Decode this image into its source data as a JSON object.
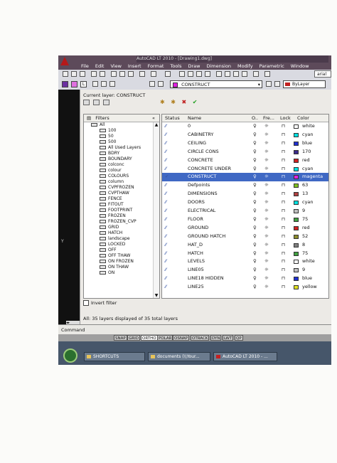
{
  "menubar": {
    "title": "AutoCAD LT 2010 - [Drawing1.dwg]",
    "items": [
      "File",
      "Edit",
      "View",
      "Insert",
      "Format",
      "Tools",
      "Draw",
      "Dimension",
      "Modify",
      "Parametric",
      "Window"
    ]
  },
  "toolbar": {
    "font_box": "arial"
  },
  "layer_toolbar": {
    "current": "CONSTRUCT",
    "color_value": "ByLayer"
  },
  "panel": {
    "current_layer_label": "Current layer: CONSTRUCT",
    "filters_label": "Filters",
    "invert_filter_label": "Invert filter",
    "status_text": "All: 35 layers displayed of 35 total layers",
    "collapse": "«"
  },
  "filter_tree": [
    "All",
    "100",
    "50",
    "500",
    "All Used Layers",
    "BDRY",
    "BOUNDARY",
    "colconc",
    "colour",
    "COLOURS",
    "column",
    "CVPFROZEN",
    "CVPTHAW",
    "FENCE",
    "FITOUT",
    "FOOTPRINT",
    "FROZEN",
    "FROZEN_CVP",
    "GRID",
    "HATCH",
    "landscape",
    "LOCKED",
    "OFF",
    "OFF THAW",
    "ON FROZEN",
    "ON THAW",
    "ON"
  ],
  "columns": {
    "status": "Status",
    "name": "Name",
    "on": "O..",
    "freeze": "Fre...",
    "lock": "Lock",
    "color": "Color"
  },
  "layers": [
    {
      "name": "0",
      "color": "white",
      "hex": "#ffffff"
    },
    {
      "name": "CABINETRY",
      "color": "cyan",
      "hex": "#00e0e0"
    },
    {
      "name": "CEILING",
      "color": "blue",
      "hex": "#2030d0"
    },
    {
      "name": "CIRCLE CONS",
      "color": "170",
      "hex": "#3a2a8c"
    },
    {
      "name": "CONCRETE",
      "color": "red",
      "hex": "#d02020"
    },
    {
      "name": "CONCRETE UNDER",
      "color": "cyan",
      "hex": "#00e0e0"
    },
    {
      "name": "CONSTRUCT",
      "color": "magenta",
      "hex": "#e020e0",
      "selected": true
    },
    {
      "name": "Defpoints",
      "color": "63",
      "hex": "#7cc020"
    },
    {
      "name": "DIMENSIONS",
      "color": "13",
      "hex": "#b04040"
    },
    {
      "name": "DOORS",
      "color": "cyan",
      "hex": "#00e0e0"
    },
    {
      "name": "ELECTRICAL",
      "color": "9",
      "hex": "#c0c0c0"
    },
    {
      "name": "FLOOR",
      "color": "75",
      "hex": "#40a040"
    },
    {
      "name": "GROUND",
      "color": "red",
      "hex": "#d02020"
    },
    {
      "name": "GROUND HATCH",
      "color": "52",
      "hex": "#8c8c2a"
    },
    {
      "name": "HAT_D",
      "color": "8",
      "hex": "#808080"
    },
    {
      "name": "HATCH",
      "color": "75",
      "hex": "#40a040"
    },
    {
      "name": "LEVELS",
      "color": "white",
      "hex": "#ffffff"
    },
    {
      "name": "LINE05",
      "color": "9",
      "hex": "#c0c0c0"
    },
    {
      "name": "LINE18 HIDDEN",
      "color": "blue",
      "hex": "#2030d0"
    },
    {
      "name": "LINE25",
      "color": "yellow",
      "hex": "#e0e020"
    }
  ],
  "command": {
    "label": "Command"
  },
  "statusbar": [
    "SNAP",
    "GRID",
    "ORTHO",
    "POLAR",
    "OSNAP",
    "OTRACK",
    "DYN",
    "LWT",
    "QP"
  ],
  "taskbar": [
    "SHORTCUTS",
    "documents (\\\\Your...",
    "AutoCAD LT 2010 - ..."
  ]
}
